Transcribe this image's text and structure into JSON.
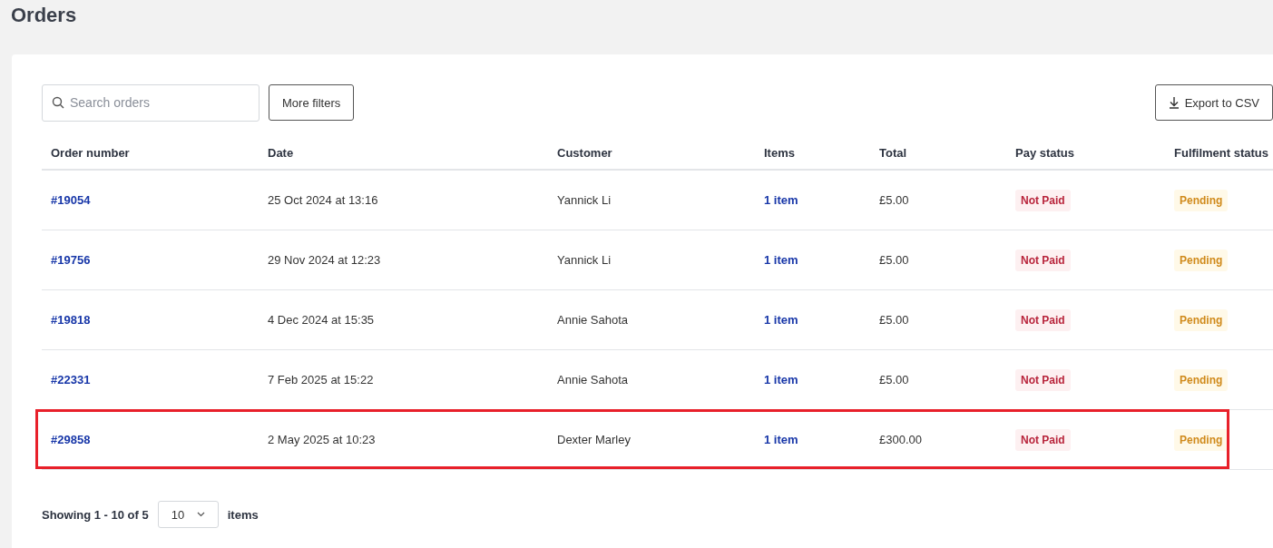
{
  "page": {
    "title": "Orders"
  },
  "toolbar": {
    "search": {
      "placeholder": "Search orders"
    },
    "filter_button": "More filters",
    "export_button": "Export to CSV"
  },
  "table": {
    "columns": [
      "Order number",
      "Date",
      "Customer",
      "Items",
      "Total",
      "Pay status",
      "Fulfilment status"
    ],
    "rows": [
      {
        "order": "#19054",
        "date": "25 Oct 2024 at 13:16",
        "customer": "Yannick Li",
        "items": "1 item",
        "total": "£5.00",
        "pay_status": "Not Paid",
        "fulfilment_status": "Pending",
        "highlighted": false
      },
      {
        "order": "#19756",
        "date": "29 Nov 2024 at 12:23",
        "customer": "Yannick Li",
        "items": "1 item",
        "total": "£5.00",
        "pay_status": "Not Paid",
        "fulfilment_status": "Pending",
        "highlighted": false
      },
      {
        "order": "#19818",
        "date": "4 Dec 2024 at 15:35",
        "customer": "Annie Sahota",
        "items": "1 item",
        "total": "£5.00",
        "pay_status": "Not Paid",
        "fulfilment_status": "Pending",
        "highlighted": false
      },
      {
        "order": "#22331",
        "date": "7 Feb 2025 at 15:22",
        "customer": "Annie Sahota",
        "items": "1 item",
        "total": "£5.00",
        "pay_status": "Not Paid",
        "fulfilment_status": "Pending",
        "highlighted": false
      },
      {
        "order": "#29858",
        "date": "2 May 2025 at 10:23",
        "customer": "Dexter Marley",
        "items": "1 item",
        "total": "£300.00",
        "pay_status": "Not Paid",
        "fulfilment_status": "Pending",
        "highlighted": true
      }
    ]
  },
  "pagination": {
    "summary": "Showing 1 - 10 of 5",
    "page_size": "10",
    "unit": "items"
  }
}
